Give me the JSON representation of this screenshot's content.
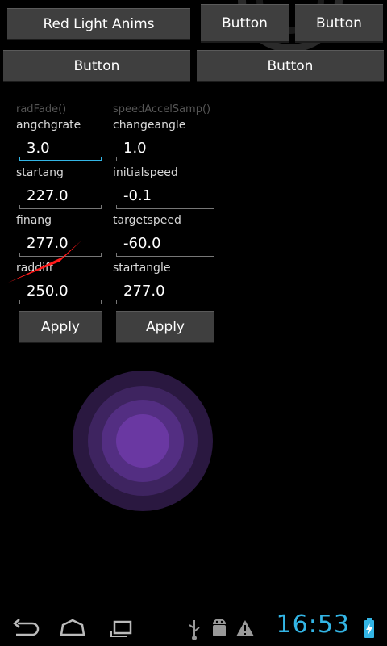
{
  "top_buttons": {
    "red_light": "Red Light Anims",
    "button1": "Button",
    "button2": "Button",
    "button3": "Button",
    "button4": "Button"
  },
  "left_column": {
    "group_title": "radFade()",
    "fields": [
      {
        "label": "angchgrate",
        "value": "3.0"
      },
      {
        "label": "startang",
        "value": "227.0"
      },
      {
        "label": "finang",
        "value": "277.0"
      },
      {
        "label": "raddiff",
        "value": "250.0"
      }
    ],
    "apply_label": "Apply"
  },
  "right_column": {
    "group_title": "speedAccelSamp()",
    "fields": [
      {
        "label": "changeangle",
        "value": "1.0"
      },
      {
        "label": "initialspeed",
        "value": "-0.1"
      },
      {
        "label": "targetspeed",
        "value": "-60.0"
      },
      {
        "label": "startangle",
        "value": "277.0"
      }
    ],
    "apply_label": "Apply"
  },
  "status_bar": {
    "time": "16:53"
  },
  "colors": {
    "accent": "#33b5e5",
    "button_bg": "#3f3f3f",
    "circle_ring1": "#2a1840",
    "circle_ring2": "#3e2460",
    "circle_ring3": "#532e82",
    "circle_core": "#6a38a2",
    "arrow": "#ff1a1a"
  },
  "icons": [
    "back-icon",
    "home-icon",
    "recent-apps-icon",
    "usb-icon",
    "android-debug-icon",
    "warning-icon",
    "battery-charging-icon"
  ]
}
